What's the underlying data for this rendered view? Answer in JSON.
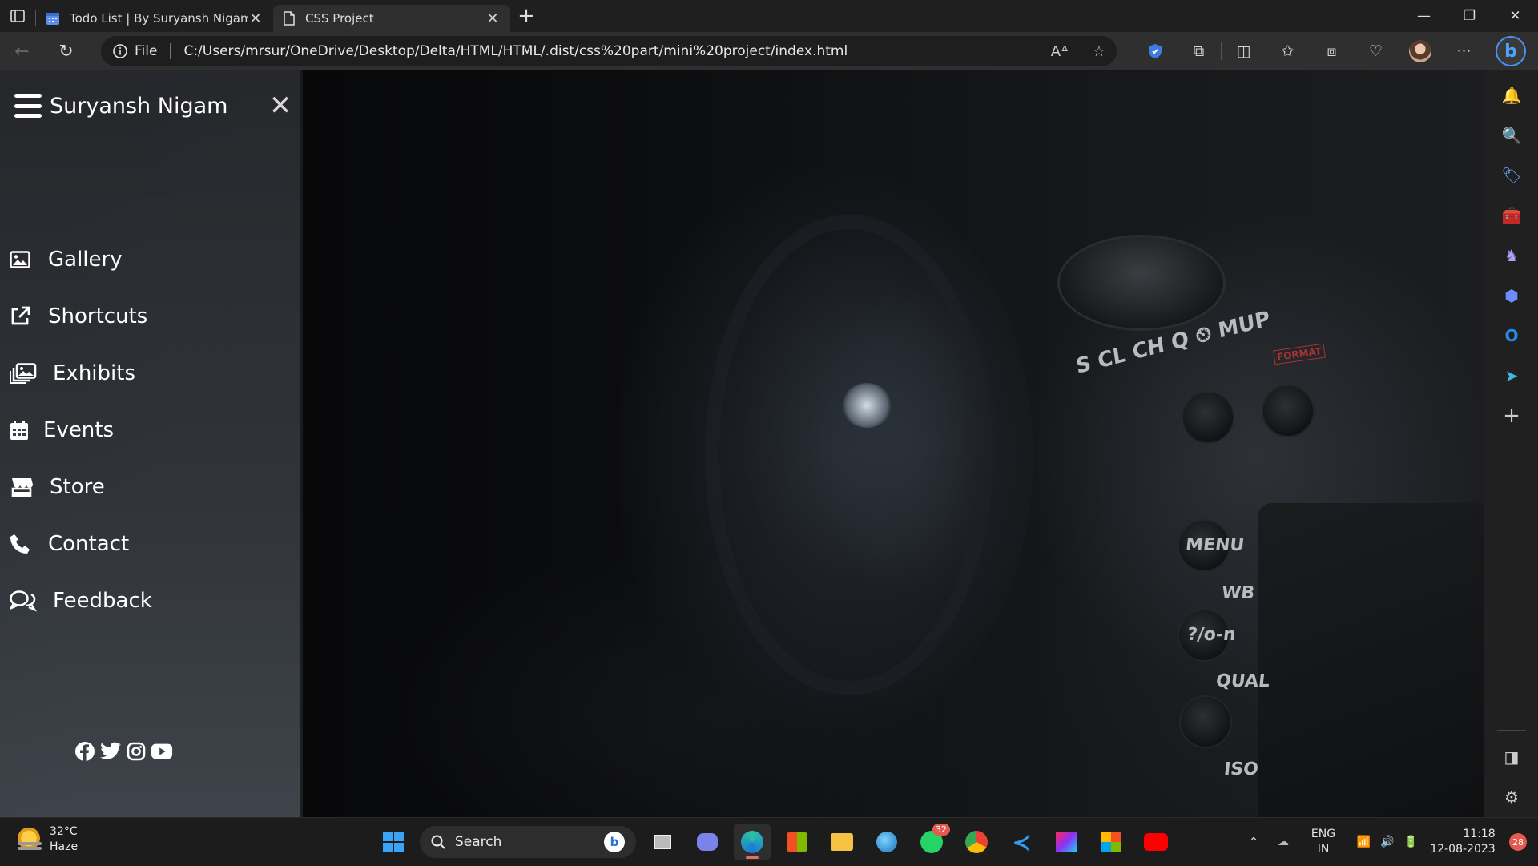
{
  "browser": {
    "tabs": [
      {
        "title": "Todo List | By Suryansh Nigam",
        "active": false
      },
      {
        "title": "CSS Project",
        "active": true
      }
    ],
    "address": {
      "scheme_label": "File",
      "url": "C:/Users/mrsur/OneDrive/Desktop/Delta/HTML/HTML/.dist/css%20part/mini%20project/index.html"
    },
    "bing_label": "b"
  },
  "page": {
    "sidebar": {
      "title": "Suryansh Nigam",
      "items": [
        {
          "label": "Gallery",
          "icon": "image-icon"
        },
        {
          "label": "Shortcuts",
          "icon": "external-link-icon"
        },
        {
          "label": "Exhibits",
          "icon": "images-icon"
        },
        {
          "label": "Events",
          "icon": "calendar-icon"
        },
        {
          "label": "Store",
          "icon": "store-icon"
        },
        {
          "label": "Contact",
          "icon": "phone-icon"
        },
        {
          "label": "Feedback",
          "icon": "comments-icon"
        }
      ],
      "social": [
        "facebook-icon",
        "twitter-icon",
        "instagram-icon",
        "youtube-icon"
      ]
    },
    "camera_labels": {
      "menu": "MENU",
      "wb": "WB",
      "lock": "?/o-n",
      "qual": "QUAL",
      "iso": "ISO",
      "modes": "S  CL  CH  Q  ⏲  MUP",
      "format": "FORMAT"
    }
  },
  "taskbar": {
    "weather": {
      "temp": "32°C",
      "condition": "Haze"
    },
    "search_placeholder": "Search",
    "whatsapp_badge": "32",
    "lang": {
      "line1": "ENG",
      "line2": "IN"
    },
    "clock": {
      "time": "11:18",
      "date": "12-08-2023"
    },
    "notifications": "28"
  },
  "colors": {
    "accent": "#4c8ff5",
    "badge": "#e55a4f",
    "sidebar_text": "#ffffff"
  }
}
